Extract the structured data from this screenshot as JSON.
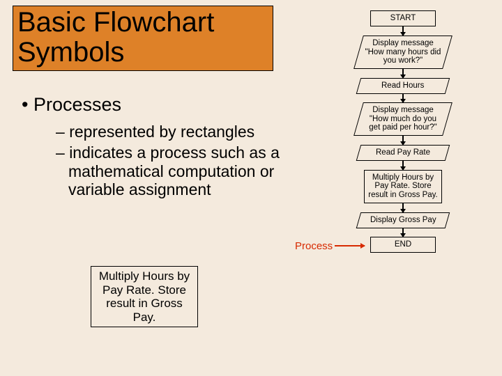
{
  "title": "Basic Flowchart Symbols",
  "bullet_main": "Processes",
  "sub1": "represented by rectangles",
  "sub2": "indicates a process such as a mathematical computation or variable assignment",
  "example_box": "Multiply Hours by Pay Rate. Store result in Gross Pay.",
  "process_label": "Process",
  "flow": {
    "start": "START",
    "msg1": "Display message \"How many hours did you work?\"",
    "readHours": "Read Hours",
    "msg2": "Display message \"How much do you get paid per hour?\"",
    "readRate": "Read Pay Rate",
    "multiply": "Multiply Hours by Pay Rate. Store result in Gross Pay.",
    "displayGross": "Display Gross Pay",
    "end": "END"
  }
}
